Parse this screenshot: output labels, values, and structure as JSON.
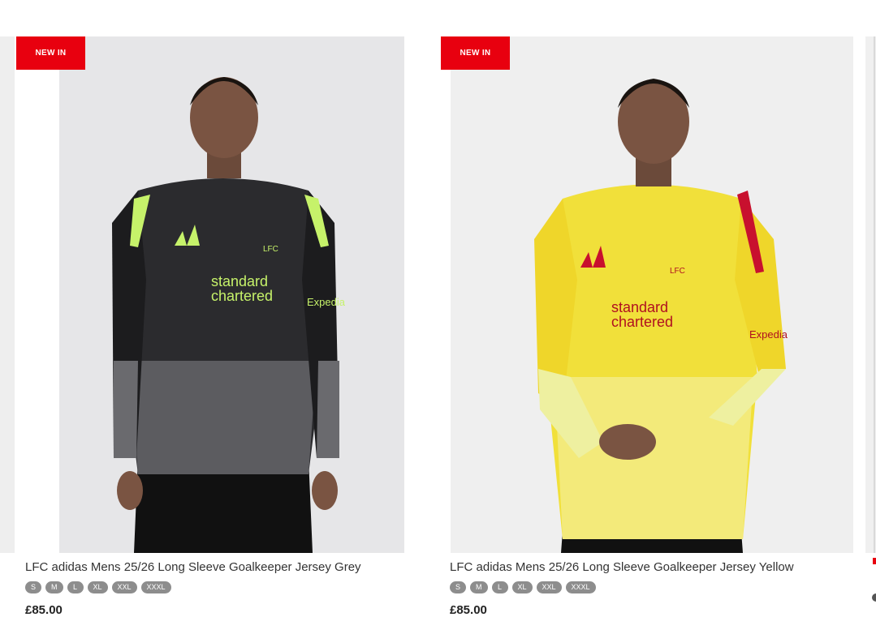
{
  "products": [
    {
      "badge": "NEW IN",
      "title": "LFC adidas Mens 25/26 Long Sleeve Goalkeeper Jersey Grey",
      "sizes": [
        "S",
        "M",
        "L",
        "XL",
        "XXL",
        "XXXL"
      ],
      "price": "£85.00",
      "sponsor_line1": "standard",
      "sponsor_line2": "chartered",
      "crest": "LFC",
      "sleeve": "Expedia"
    },
    {
      "badge": "NEW IN",
      "title": "LFC adidas Mens 25/26 Long Sleeve Goalkeeper Jersey Yellow",
      "sizes": [
        "S",
        "M",
        "L",
        "XL",
        "XXL",
        "XXXL"
      ],
      "price": "£85.00",
      "sponsor_line1": "standard",
      "sponsor_line2": "chartered",
      "crest": "LFC",
      "sleeve": "Expedia"
    }
  ],
  "colors": {
    "badge": "#e8000f",
    "size_pill": "#8d8d8d",
    "jersey_grey": "#2b2b2e",
    "jersey_yellow": "#f1e03a",
    "accent_green": "#c6f26a",
    "accent_red": "#c8102e"
  }
}
